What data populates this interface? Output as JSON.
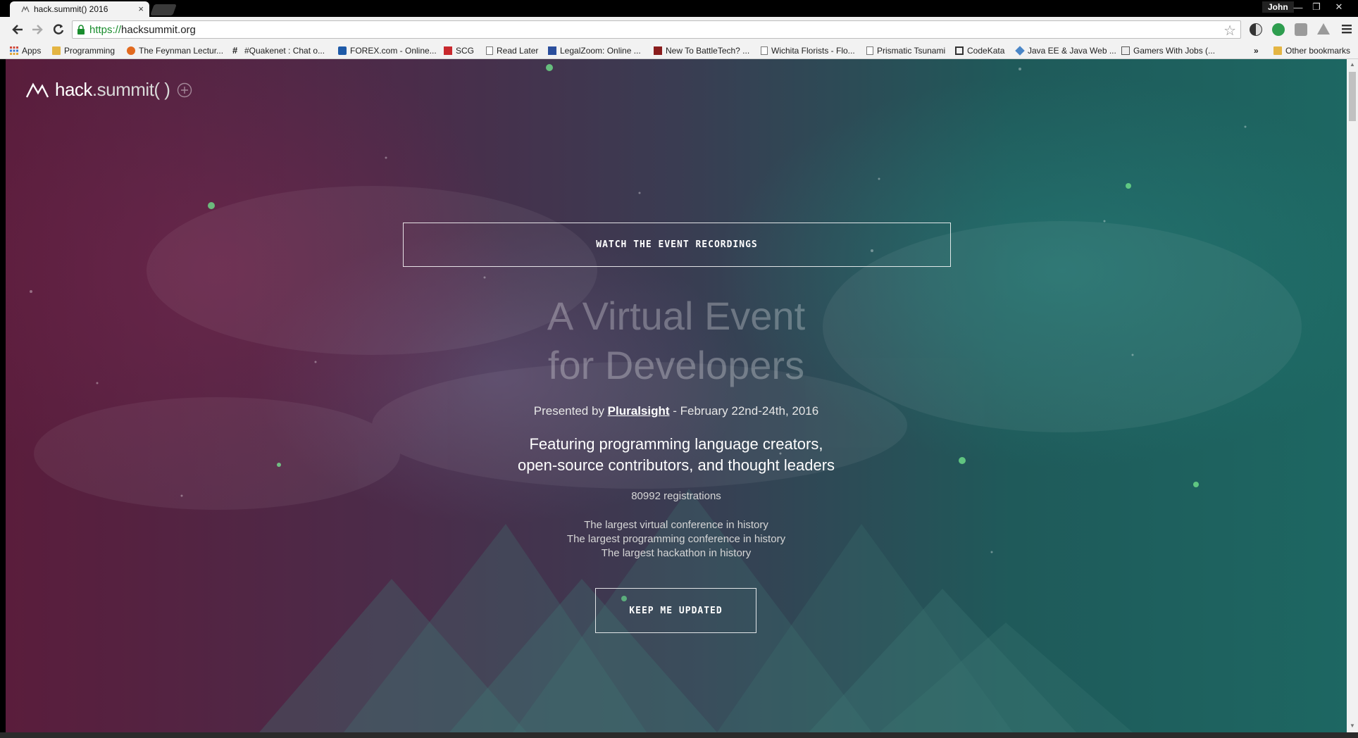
{
  "browser": {
    "tab_title": "hack.summit() 2016",
    "tab_close": "×",
    "profile_name": "John",
    "window_buttons": [
      "—",
      "❐",
      "✕"
    ],
    "url_scheme": "https://",
    "url_host": "hacksummit.org",
    "bookmarks": [
      {
        "label": "Apps",
        "icon": "apps-grid-icon"
      },
      {
        "label": "Programming",
        "icon": "folder-icon"
      },
      {
        "label": "The Feynman Lectur...",
        "icon": "flame-icon"
      },
      {
        "label": "#Quakenet : Chat o...",
        "icon": "hash-icon"
      },
      {
        "label": "FOREX.com - Online...",
        "icon": "forex-icon"
      },
      {
        "label": "SCG",
        "icon": "scg-icon"
      },
      {
        "label": "Read Later",
        "icon": "page-icon"
      },
      {
        "label": "LegalZoom: Online ...",
        "icon": "legalzoom-icon"
      },
      {
        "label": "New To BattleTech? ...",
        "icon": "battletech-icon"
      },
      {
        "label": "Wichita Florists - Flo...",
        "icon": "page-icon"
      },
      {
        "label": "Prismatic Tsunami",
        "icon": "page-icon"
      },
      {
        "label": "CodeKata",
        "icon": "codekata-icon"
      },
      {
        "label": "Java EE & Java Web ...",
        "icon": "java-icon"
      },
      {
        "label": "Gamers With Jobs (...",
        "icon": "gamers-icon"
      }
    ],
    "bookmarks_overflow": "»",
    "other_bookmarks": "Other bookmarks"
  },
  "page": {
    "logo_primary": "hack",
    "logo_secondary": ".summit( )",
    "watch_button": "WATCH THE EVENT RECORDINGS",
    "headline_line1": "A Virtual Event",
    "headline_line2": "for Developers",
    "presented_prefix": "Presented by ",
    "presented_link": "Pluralsight",
    "presented_suffix": " - February 22nd-24th, 2016",
    "featuring_line1": "Featuring programming language creators,",
    "featuring_line2": "open-source contributors, and thought leaders",
    "registrations": "80992 registrations",
    "largest": [
      "The largest virtual conference in history",
      "The largest programming conference in history",
      "The largest hackathon in history"
    ],
    "keep_button": "KEEP ME UPDATED"
  },
  "colors": {
    "accent_green": "#1a8d2e",
    "bg_magenta": "#5a1d3c",
    "bg_teal": "#1d6762"
  }
}
